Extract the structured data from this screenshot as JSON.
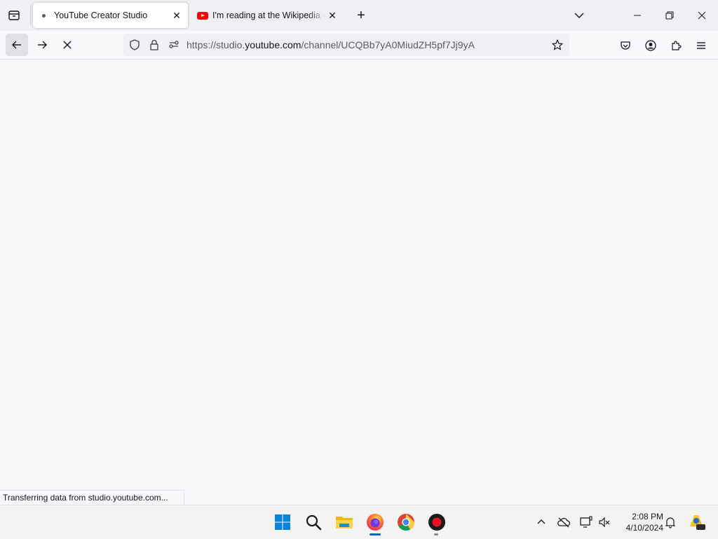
{
  "tabs": [
    {
      "title": "YouTube Creator Studio",
      "active": true
    },
    {
      "title": "I'm reading at the Wikipedia - YouTube",
      "active": false
    }
  ],
  "url": {
    "prefix": "https://studio.",
    "host": "youtube.com",
    "path": "/channel/UCQBb7yA0MiudZH5pf7Jj9yA"
  },
  "status_text": "Transferring data from studio.youtube.com...",
  "clock": {
    "time": "2:08 PM",
    "date": "4/10/2024"
  },
  "colors": {
    "accent": "#0067c0",
    "youtube_red": "#ff0000",
    "recorder_red": "#e81123"
  },
  "icons": [
    "tab-list-icon",
    "close-icon",
    "plus-icon",
    "chevron-down-icon",
    "back-arrow-icon",
    "forward-arrow-icon",
    "stop-icon",
    "shield-icon",
    "lock-icon",
    "permissions-icon",
    "star-icon",
    "pocket-icon",
    "account-icon",
    "extensions-icon",
    "menu-icon",
    "windows-start-icon",
    "search-icon",
    "file-explorer-icon",
    "firefox-icon",
    "chrome-icon",
    "recorder-icon",
    "chevron-up-icon",
    "cloud-off-icon",
    "display-icon",
    "sound-icon",
    "bell-icon",
    "copilot-icon"
  ]
}
